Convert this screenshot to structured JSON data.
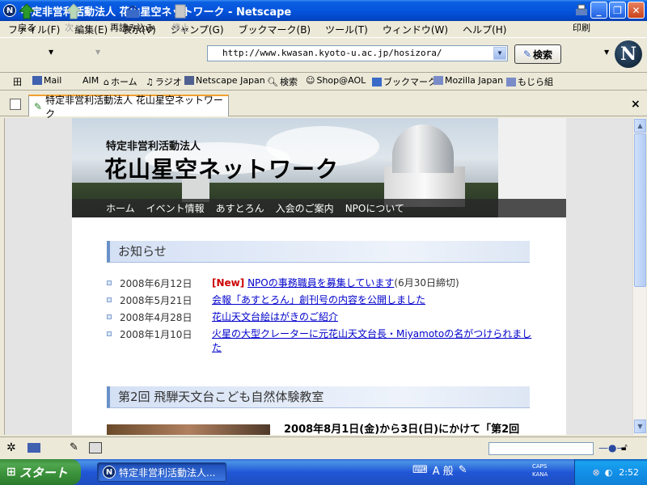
{
  "window": {
    "title": "特定非営利活動法人 花山星空ネットワーク - Netscape",
    "icon_letter": "N"
  },
  "menu": [
    "ファイル(F)",
    "編集(E)",
    "表示(V)",
    "ジャンプ(G)",
    "ブックマーク(B)",
    "ツール(T)",
    "ウィンドウ(W)",
    "ヘルプ(H)"
  ],
  "nav": {
    "back": "戻る",
    "forward": "次へ",
    "reload": "再読み込み",
    "stop": "停止",
    "print": "印刷",
    "search": "検索"
  },
  "url": "http://www.kwasan.kyoto-u.ac.jp/hosizora/",
  "personal_bar": [
    "Mail",
    "AIM",
    "ホーム",
    "ラジオ",
    "Netscape Japan",
    "検索",
    "Shop@AOL",
    "ブックマーク",
    "Mozilla Japan",
    "もじら組"
  ],
  "tab": {
    "label": "特定非営利活動法人 花山星空ネットワーク",
    "close": "×"
  },
  "site": {
    "subtitle": "特定非営利活動法人",
    "title": "花山星空ネットワーク",
    "nav": [
      "ホーム",
      "イベント情報",
      "あすとろん",
      "入会のご案内",
      "NPOについて"
    ],
    "news_heading": "お知らせ",
    "news": [
      {
        "date": "2008年6月12日",
        "tag": "[New]",
        "text": "NPOの事務職員を募集しています",
        "note": "(6月30日締切)"
      },
      {
        "date": "2008年5月21日",
        "tag": "",
        "text": "会報「あすとろん」創刊号の内容を公開しました",
        "note": ""
      },
      {
        "date": "2008年4月28日",
        "tag": "",
        "text": "花山天文台絵はがきのご紹介",
        "note": ""
      },
      {
        "date": "2008年1月10日",
        "tag": "",
        "text": "火星の大型クレーターに元花山天文台長・Miyamotoの名がつけられました",
        "note": ""
      }
    ],
    "event_heading": "第2回 飛騨天文台こども自然体験教室",
    "event_text": "2008年8月1日(金)から3日(日)にかけて「第2回"
  },
  "taskbar": {
    "start": "スタート",
    "task": "特定非営利活動法人...",
    "clock": "2:52",
    "ime": "A 般",
    "caps": "CAPS",
    "kana": "KANA"
  }
}
